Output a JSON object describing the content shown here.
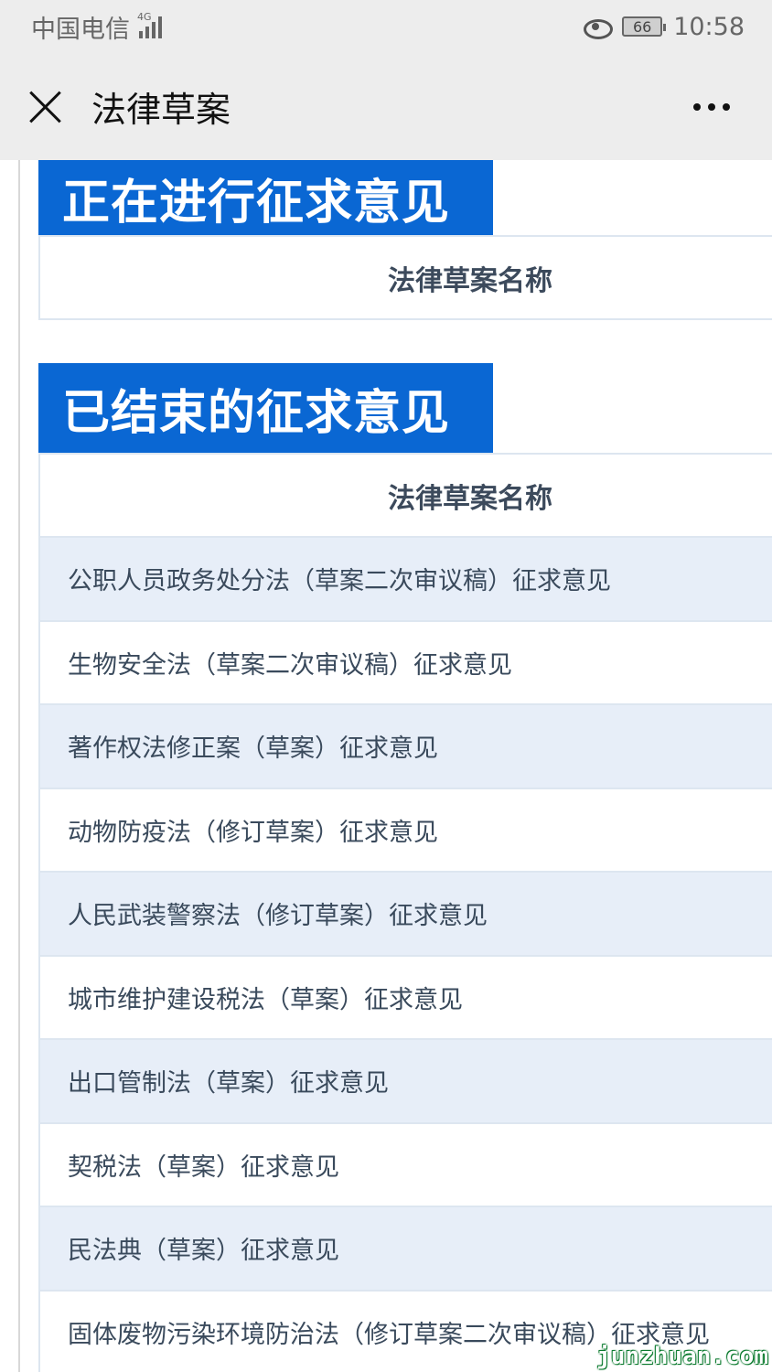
{
  "status_bar": {
    "carrier": "中国电信",
    "network": "4G",
    "battery": "66",
    "time": "10:58"
  },
  "nav": {
    "title": "法律草案"
  },
  "sections": {
    "ongoing": {
      "title": "正在进行征求意见",
      "column_header": "法律草案名称"
    },
    "finished": {
      "title": "已结束的征求意见",
      "column_header": "法律草案名称",
      "items": [
        "公职人员政务处分法（草案二次审议稿）征求意见",
        "生物安全法（草案二次审议稿）征求意见",
        "著作权法修正案（草案）征求意见",
        "动物防疫法（修订草案）征求意见",
        "人民武装警察法（修订草案）征求意见",
        "城市维护建设税法（草案）征求意见",
        "出口管制法（草案）征求意见",
        "契税法（草案）征求意见",
        "民法典（草案）征求意见",
        "固体废物污染环境防治法（修订草案二次审议稿）征求意见"
      ]
    }
  },
  "watermark": "junzhuan.com",
  "colors": {
    "header_blue": "#0a67d3",
    "row_tint": "#e7eef8",
    "nav_bg": "#ededed"
  }
}
